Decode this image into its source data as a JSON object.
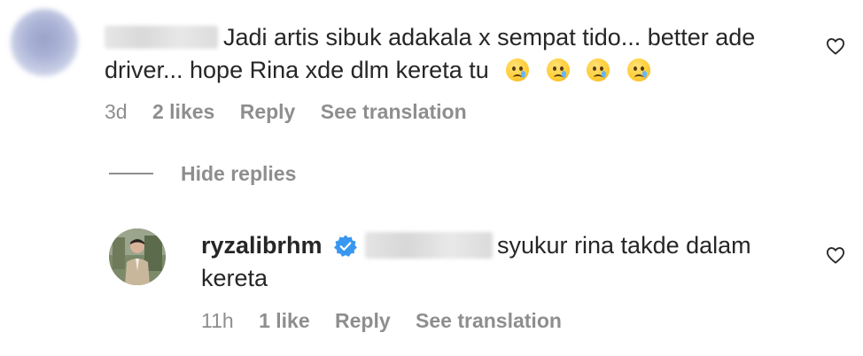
{
  "comment": {
    "text_line1": "Jadi artis sibuk adakala x sempat tido... better ade",
    "text_line2": "driver... hope Rina xde dlm kereta tu",
    "emoji_icons": [
      "crying-face-icon",
      "crying-face-icon",
      "crying-face-icon",
      "crying-face-icon"
    ],
    "time": "3d",
    "likes": "2 likes",
    "reply_label": "Reply",
    "translate_label": "See translation"
  },
  "hide_replies_label": "Hide replies",
  "reply": {
    "username": "ryzalibrhm",
    "text_line1": "syukur rina takde dalam",
    "text_line2": "kereta",
    "time": "11h",
    "likes": "1 like",
    "reply_label": "Reply",
    "translate_label": "See translation"
  },
  "colors": {
    "text": "#262626",
    "muted": "#8e8e8e",
    "verified": "#3897f0"
  }
}
